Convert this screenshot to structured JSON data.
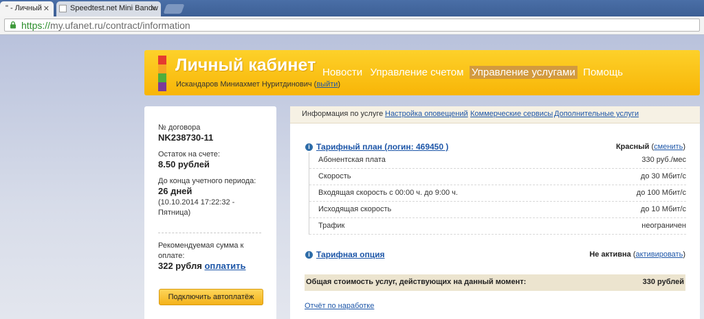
{
  "browser": {
    "tabs": [
      {
        "title": "\" - Личный"
      },
      {
        "title": "Speedtest.net Mini Bandw"
      }
    ],
    "url_protocol": "https://",
    "url_rest": "my.ufanet.ru/contract/information"
  },
  "header": {
    "title": "Личный кабинет",
    "user_name": "Искандаров Миниахмет Нуритдинович (",
    "logout_label": "выйти",
    "user_name_close": ")",
    "nav": [
      {
        "label": "Новости"
      },
      {
        "label": "Управление счетом"
      },
      {
        "label": "Управление услугами"
      },
      {
        "label": "Помощь"
      }
    ],
    "logo_colors": [
      "#e53b2f",
      "#f6a524",
      "#4fae3c",
      "#7b3a9a"
    ]
  },
  "sidebar": {
    "contract_label": "№ договора",
    "contract_number": "NK238730-11",
    "balance_label": "Остаток на счете:",
    "balance_value": "8.50 рублей",
    "period_label": "До конца учетного периода:",
    "period_value": "26 дней",
    "period_date": "(10.10.2014 17:22:32 -",
    "period_day": "Пятница)",
    "recommended_label_1": "Рекомендуемая сумма к",
    "recommended_label_2": "оплате:",
    "recommended_value": "322 рубля",
    "pay_link": "оплатить",
    "autopay_button": "Подключить автоплатёж"
  },
  "main": {
    "subtabs": [
      {
        "label": "Информация по услуге"
      },
      {
        "label": "Настройка оповещений"
      },
      {
        "label": "Коммерческие сервисы"
      },
      {
        "label": "Дополнительные услуги"
      }
    ],
    "tariff": {
      "title": "Тарифный план (логин: 469450 )",
      "plan_name": "Красный",
      "change_link": "сменить",
      "rows": [
        {
          "label": "Абонентская плата",
          "value": "330 руб./мес"
        },
        {
          "label": "Скорость",
          "value": "до 30 Мбит/с"
        },
        {
          "label": "Входящая скорость с 00:00 ч. до 9:00 ч.",
          "value": "до 100 Мбит/с"
        },
        {
          "label": "Исходящая скорость",
          "value": "до 10 Мбит/с"
        },
        {
          "label": "Трафик",
          "value": "неограничен"
        }
      ]
    },
    "option": {
      "title": "Тарифная опция",
      "status": "Не активна",
      "activate_link": "активировать"
    },
    "total": {
      "label": "Общая стоимость услуг, действующих на данный момент:",
      "value": "330 рублей"
    },
    "report_link": "Отчёт по наработке"
  }
}
